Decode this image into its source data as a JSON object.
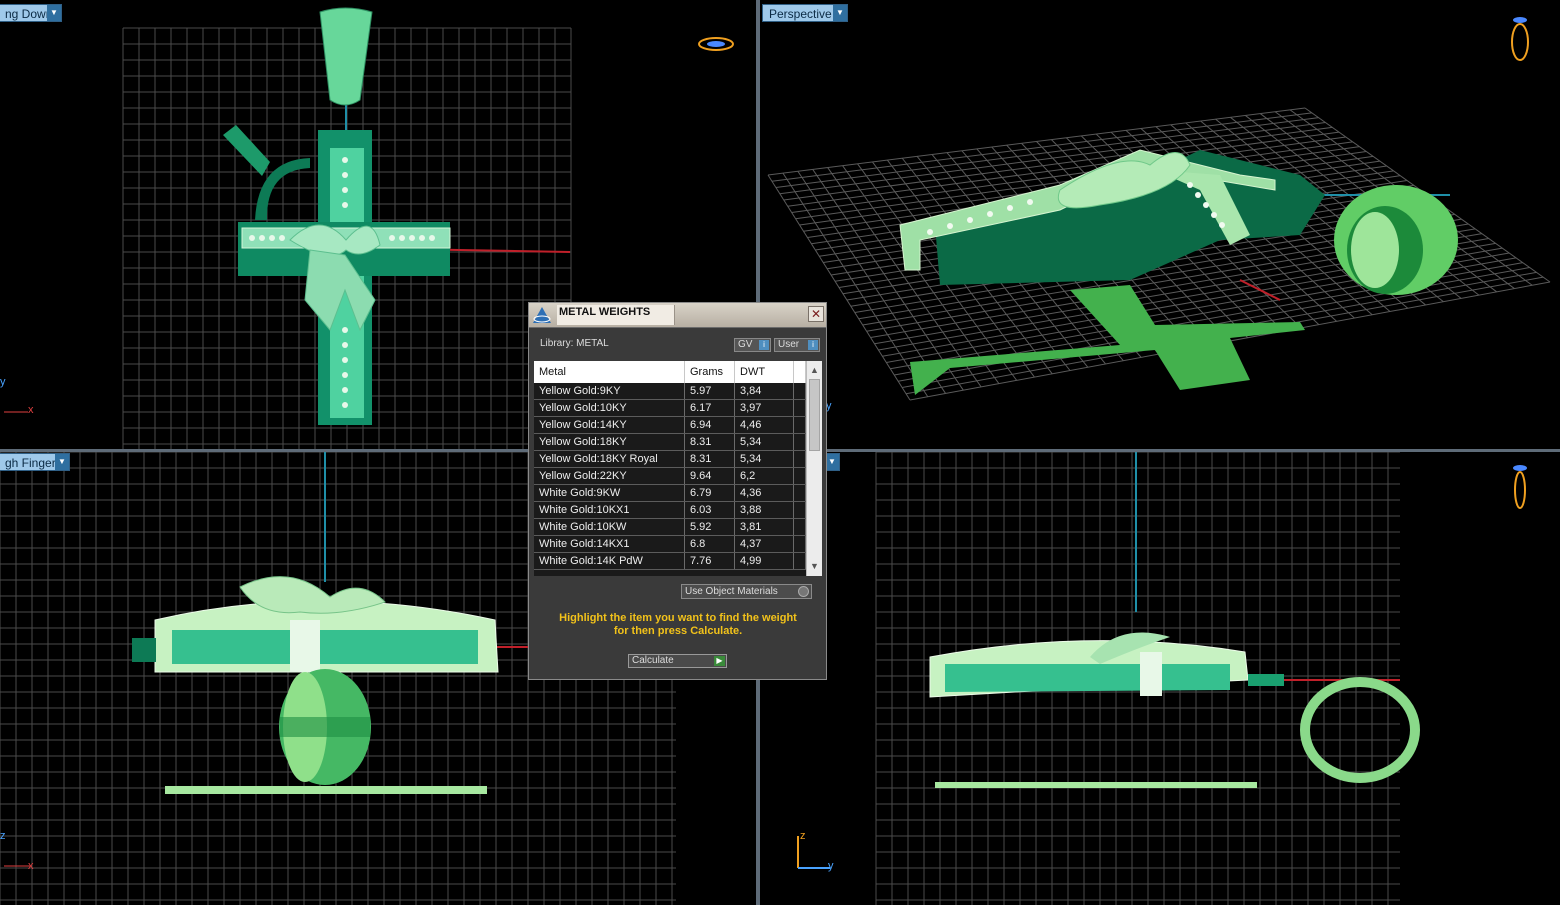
{
  "viewports": {
    "top_left": {
      "label": "ng Down"
    },
    "top_right": {
      "label": "Perspective"
    },
    "bottom_left": {
      "label": "gh Finger"
    },
    "bottom_right": {
      "label": ""
    }
  },
  "axes": {
    "tl": {
      "y": "y",
      "x": "x"
    },
    "tr": {
      "y": "y"
    },
    "bl": {
      "z": "z",
      "x": "x"
    },
    "br": {
      "z": "z",
      "y": "y"
    }
  },
  "dialog": {
    "title": "METAL WEIGHTS",
    "close": "✕",
    "library_label": "Library: METAL",
    "gv_label": "GV",
    "user_label": "User",
    "columns": [
      "Metal",
      "Grams",
      "DWT"
    ],
    "rows": [
      {
        "metal": "Yellow Gold:9KY",
        "grams": "5.97",
        "dwt": "3,84"
      },
      {
        "metal": "Yellow Gold:10KY",
        "grams": "6.17",
        "dwt": "3,97"
      },
      {
        "metal": "Yellow Gold:14KY",
        "grams": "6.94",
        "dwt": "4,46"
      },
      {
        "metal": "Yellow Gold:18KY",
        "grams": "8.31",
        "dwt": "5,34"
      },
      {
        "metal": "Yellow Gold:18KY Royal",
        "grams": "8.31",
        "dwt": "5,34"
      },
      {
        "metal": "Yellow Gold:22KY",
        "grams": "9.64",
        "dwt": "6,2"
      },
      {
        "metal": "White Gold:9KW",
        "grams": "6.79",
        "dwt": "4,36"
      },
      {
        "metal": "White Gold:10KX1",
        "grams": "6.03",
        "dwt": "3,88"
      },
      {
        "metal": "White Gold:10KW",
        "grams": "5.92",
        "dwt": "3,81"
      },
      {
        "metal": "White Gold:14KX1",
        "grams": "6.8",
        "dwt": "4,37"
      },
      {
        "metal": "White Gold:14K PdW",
        "grams": "7.76",
        "dwt": "4,99"
      }
    ],
    "use_object_materials": "Use Object Materials",
    "hint_line1": "Highlight the item you want to find the weight",
    "hint_line2": "for then press Calculate.",
    "calculate": "Calculate"
  },
  "colors": {
    "model_dark": "#0e7a55",
    "model_mid": "#3fbf8c",
    "model_light": "#b9e8b5",
    "grid": "#5a5a5a",
    "hint": "#f2c21a"
  }
}
